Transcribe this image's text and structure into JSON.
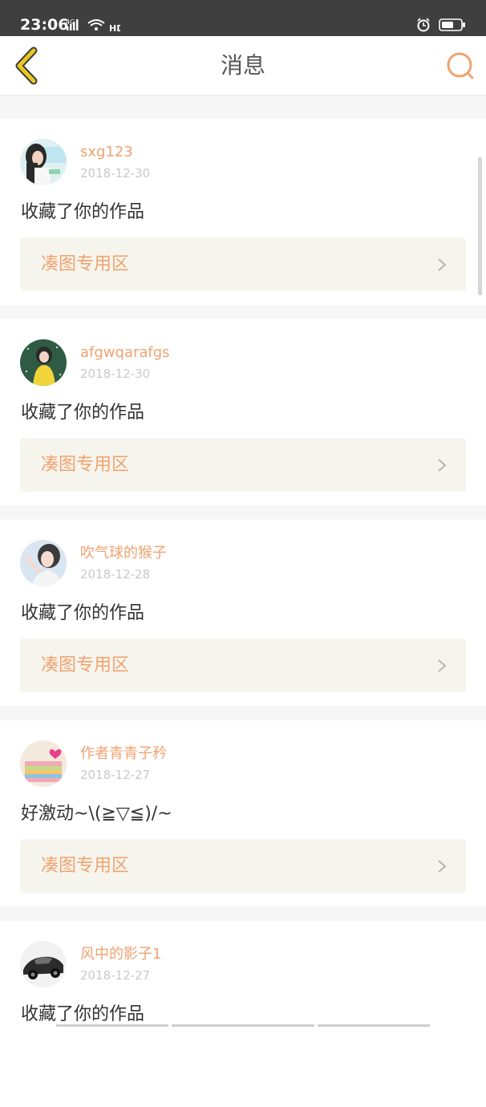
{
  "status_bar": {
    "time": "23:06",
    "network": "4G",
    "hd": "HD"
  },
  "header": {
    "title": "消息"
  },
  "colors": {
    "accent": "#f0a270",
    "link_bg": "#f6f5ed",
    "back": "#e8c820"
  },
  "messages": [
    {
      "username": "sxg123",
      "date": "2018-12-30",
      "text": "收藏了你的作品",
      "work": "凑图专用区"
    },
    {
      "username": "afgwqarafgs",
      "date": "2018-12-30",
      "text": "收藏了你的作品",
      "work": "凑图专用区"
    },
    {
      "username": "吹气球的猴子",
      "date": "2018-12-28",
      "text": "收藏了你的作品",
      "work": "凑图专用区"
    },
    {
      "username": "作者青青子矜",
      "date": "2018-12-27",
      "text": "好激动~\\(≧▽≦)/~",
      "work": "凑图专用区"
    },
    {
      "username": "风中的影子1",
      "date": "2018-12-27",
      "text": "收藏了你的作品",
      "work": "凑图专用区"
    }
  ]
}
